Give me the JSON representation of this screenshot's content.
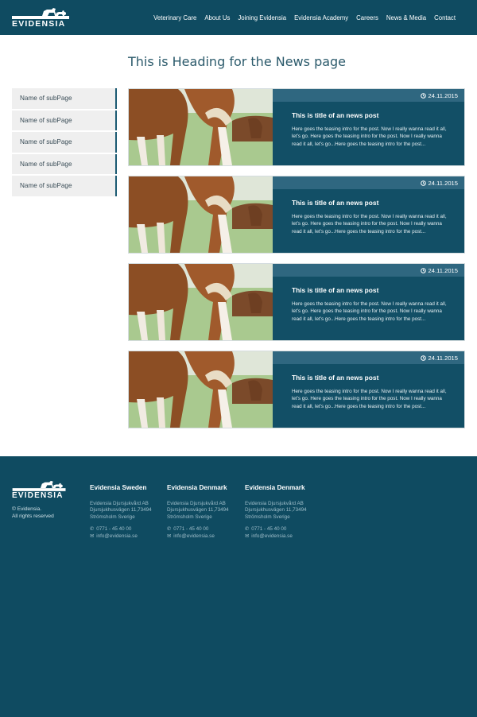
{
  "brand": {
    "name": "EVIDENSIA",
    "accent": "#0f4b61"
  },
  "nav": {
    "items": [
      "Veterinary Care",
      "About Us",
      "Joining Evidensia",
      "Evidensia Academy",
      "Careers",
      "News & Media",
      "Contact"
    ]
  },
  "page": {
    "title": "This is Heading for the News page"
  },
  "sidebar": {
    "items": [
      "Name of subPage",
      "Name of subPage",
      "Name of subPage",
      "Name of subPage",
      "Name of subPage"
    ]
  },
  "posts": [
    {
      "date": "24.11.2015",
      "title": "This is title of an news post",
      "text": "Here goes the teasing intro for the post. Now I really wanna read it all, let’s go. Here goes the teasing intro for the post. Now I really wanna read it all, let’s go...Here goes the teasing intro for the post...",
      "image": "horses-grazing-image"
    },
    {
      "date": "24.11.2015",
      "title": "This is title of an news post",
      "text": "Here goes the teasing intro for the post. Now I really wanna read it all, let’s go. Here goes the teasing intro for the post. Now I really wanna read it all, let’s go...Here goes the teasing intro for the post...",
      "image": "horses-grazing-image"
    },
    {
      "date": "24.11.2015",
      "title": "This is title of an news post",
      "text": "Here goes the teasing intro for the post. Now I really wanna read it all, let’s go. Here goes the teasing intro for the post. Now I really wanna read it all, let’s go...Here goes the teasing intro for the post...",
      "image": "horses-grazing-image"
    },
    {
      "date": "24.11.2015",
      "title": "This is title of an news post",
      "text": "Here goes the teasing intro for the post. Now I really wanna read it all, let’s go. Here goes the teasing intro for the post. Now I really wanna read it all, let’s go...Here goes the teasing intro for the post...",
      "image": "horses-grazing-image"
    }
  ],
  "footer": {
    "copyright": "© Evidensia.",
    "rights": "All rights reserved",
    "offices": [
      {
        "title": "Evidensia Sweden",
        "company": "Evidensia Djursjukvård AB",
        "street": "Djursjukhusvägen 11,73494",
        "city": "Strömsholm Sverige",
        "phone": "0771 - 45 40 00",
        "email": "info@evidensia.se"
      },
      {
        "title": "Evidensia Denmark",
        "company": "Evidensia Djursjukvård AB",
        "street": "Djursjukhusvägen 11,73494",
        "city": "Strömsholm Sverige",
        "phone": "0771 - 45 40 00",
        "email": "info@evidensia.se"
      },
      {
        "title": "Evidensia Denmark",
        "company": "Evidensia Djursjukvård AB",
        "street": "Djursjukhusvägen 11,73494",
        "city": "Strömsholm Sverige",
        "phone": "0771 - 45 40 00",
        "email": "info@evidensia.se"
      }
    ]
  },
  "icons": {
    "clock": "clock-icon",
    "phone": "phone-icon",
    "email": "email-icon"
  }
}
